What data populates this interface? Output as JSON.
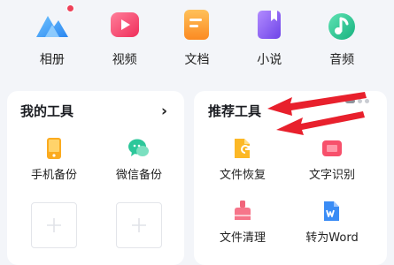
{
  "categories": [
    {
      "label": "相册",
      "icon": "album-icon",
      "has_badge": true
    },
    {
      "label": "视频",
      "icon": "video-icon",
      "has_badge": false
    },
    {
      "label": "文档",
      "icon": "document-icon",
      "has_badge": false
    },
    {
      "label": "小说",
      "icon": "novel-icon",
      "has_badge": false
    },
    {
      "label": "音频",
      "icon": "audio-icon",
      "has_badge": false
    }
  ],
  "my_tools": {
    "title": "我的工具",
    "items": [
      {
        "label": "手机备份",
        "icon": "phone-backup-icon"
      },
      {
        "label": "微信备份",
        "icon": "wechat-backup-icon"
      }
    ],
    "add_slots": 2
  },
  "recommended_tools": {
    "title": "推荐工具",
    "items": [
      {
        "label": "文件恢复",
        "icon": "file-recovery-icon"
      },
      {
        "label": "文字识别",
        "icon": "text-recognition-icon"
      },
      {
        "label": "文件清理",
        "icon": "file-cleanup-icon"
      },
      {
        "label": "转为Word",
        "icon": "convert-to-word-icon"
      }
    ]
  },
  "colors": {
    "album": "#3f9cf7",
    "video": "#f5466a",
    "document": "#fb9a2c",
    "novel": "#8a63f3",
    "audio": "#2bc996",
    "annotation_arrow": "#e8202c",
    "badge": "#ee4058"
  }
}
